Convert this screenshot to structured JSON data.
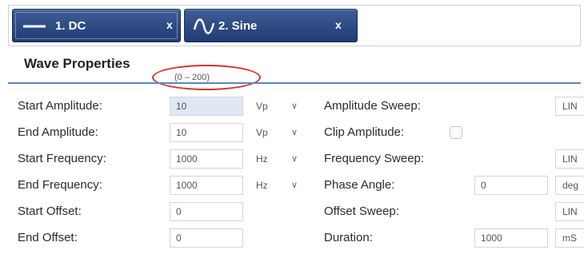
{
  "tabs": [
    {
      "label": "1. DC",
      "icon": "dc-line-icon",
      "close": "x"
    },
    {
      "label": "2. Sine",
      "icon": "sine-wave-icon",
      "close": "x"
    }
  ],
  "section": {
    "title": "Wave Properties",
    "range_hint": "(0 – 200)",
    "highlight_color": "#d8322b"
  },
  "rows": [
    {
      "left_label": "Start Amplitude:",
      "value": "10",
      "unit": "Vp",
      "right_label": "Amplitude Sweep:",
      "right_value": "LIN"
    },
    {
      "left_label": "End Amplitude:",
      "value": "10",
      "unit": "Vp",
      "right_label": "Clip Amplitude:"
    },
    {
      "left_label": "Start Frequency:",
      "value": "1000",
      "unit": "Hz",
      "right_label": "Frequency Sweep:",
      "right_value": "LIN"
    },
    {
      "left_label": "End Frequency:",
      "value": "1000",
      "unit": "Hz",
      "right_label": "Phase Angle:",
      "right_input": "0",
      "right_value": "deg"
    },
    {
      "left_label": "Start Offset:",
      "value": "0",
      "right_label": "Offset Sweep:",
      "right_value": "LIN"
    },
    {
      "left_label": "End Offset:",
      "value": "0",
      "right_label": "Duration:",
      "right_input": "1000",
      "right_value": "mS"
    }
  ],
  "colors": {
    "tab_active": "#213b74",
    "divider": "#5a86c4"
  }
}
